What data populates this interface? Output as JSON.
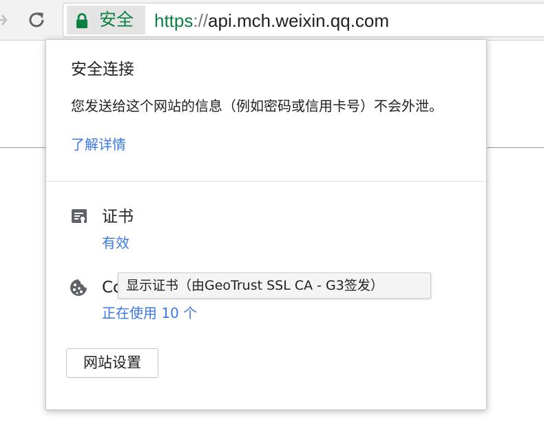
{
  "toolbar": {
    "chip_text": "安全",
    "url_scheme": "https",
    "url_separator": "://",
    "url_host": "api.mch.weixin.qq.com"
  },
  "popup": {
    "title": "安全连接",
    "description": "您发送给这个网站的信息（例如密码或信用卡号）不会外泄。",
    "learn_more": "了解详情",
    "certificate": {
      "label": "证书",
      "status": "有效"
    },
    "cookies": {
      "label_visible": "Co",
      "status": "正在使用 10 个"
    },
    "tooltip": "显示证书（由GeoTrust SSL CA - G3签发）",
    "site_settings_button": "网站设置"
  },
  "colors": {
    "secure_green": "#0b8043",
    "link_blue": "#3b78e7",
    "icon_gray": "#5f6368"
  },
  "icons": {
    "forward": "forward-arrow-icon",
    "reload": "reload-icon",
    "lock": "lock-icon",
    "certificate": "certificate-icon",
    "cookie": "cookie-icon"
  }
}
